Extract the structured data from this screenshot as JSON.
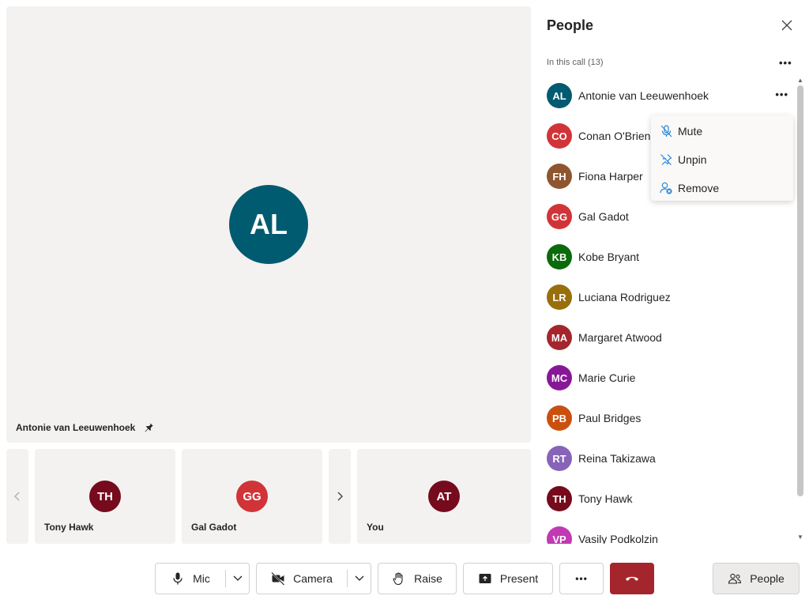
{
  "stage": {
    "spotlight": {
      "initials": "AL",
      "name": "Antonie van Leeuwenhoek",
      "color": "#005b70"
    },
    "tiles": [
      {
        "initials": "TH",
        "name": "Tony Hawk",
        "color": "#750b1c"
      },
      {
        "initials": "GG",
        "name": "Gal Gadot",
        "color": "#d13438"
      },
      {
        "initials": "AT",
        "name": "You",
        "color": "#750b1c"
      }
    ]
  },
  "panel": {
    "title": "People",
    "section_label": "In this call (13)",
    "people": [
      {
        "initials": "AL",
        "name": "Antonie van Leeuwenhoek",
        "color": "#005b70"
      },
      {
        "initials": "CO",
        "name": "Conan O'Brien",
        "color": "#d13438"
      },
      {
        "initials": "FH",
        "name": "Fiona Harper",
        "color": "#8e562e"
      },
      {
        "initials": "GG",
        "name": "Gal Gadot",
        "color": "#d13438"
      },
      {
        "initials": "KB",
        "name": "Kobe Bryant",
        "color": "#0b6a0b"
      },
      {
        "initials": "LR",
        "name": "Luciana Rodriguez",
        "color": "#986f0b"
      },
      {
        "initials": "MA",
        "name": "Margaret Atwood",
        "color": "#a4262c"
      },
      {
        "initials": "MC",
        "name": "Marie Curie",
        "color": "#881798"
      },
      {
        "initials": "PB",
        "name": "Paul Bridges",
        "color": "#ca5010"
      },
      {
        "initials": "RT",
        "name": "Reina Takizawa",
        "color": "#8764b8"
      },
      {
        "initials": "TH",
        "name": "Tony Hawk",
        "color": "#750b1c"
      },
      {
        "initials": "VP",
        "name": "Vasily Podkolzin",
        "color": "#c239b3"
      }
    ]
  },
  "menu": {
    "items": [
      {
        "label": "Mute",
        "icon": "mic-off-icon"
      },
      {
        "label": "Unpin",
        "icon": "pin-off-icon"
      },
      {
        "label": "Remove",
        "icon": "person-remove-icon"
      }
    ]
  },
  "toolbar": {
    "mic_label": "Mic",
    "camera_label": "Camera",
    "raise_label": "Raise",
    "present_label": "Present",
    "more_label": "•••",
    "people_label": "People",
    "hangup_color": "#a4262c"
  }
}
